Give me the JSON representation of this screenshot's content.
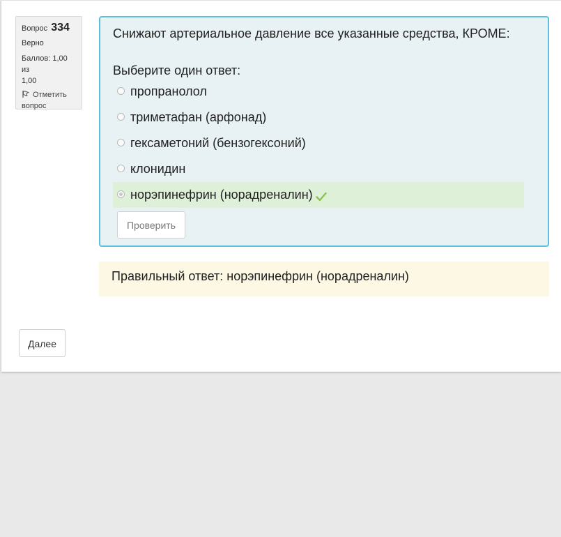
{
  "question_info": {
    "question_word": "Вопрос",
    "number": "334",
    "state": "Верно",
    "grade_line1": "Баллов: 1,00 из",
    "grade_line2": "1,00",
    "flag_line1": "Отметить",
    "flag_line2": "вопрос"
  },
  "question": {
    "text": "Снижают артериальное давление все указанные средства, КРОМЕ:",
    "prompt": "Выберите один ответ:",
    "options": [
      {
        "label": "пропранолол",
        "selected": false
      },
      {
        "label": "триметафан (арфонад)",
        "selected": false
      },
      {
        "label": "гексаметоний (бензогексоний)",
        "selected": false
      },
      {
        "label": "клонидин",
        "selected": false
      },
      {
        "label": "норэпинефрин (норадреналин)",
        "selected": true,
        "correct": true
      }
    ],
    "check_button": "Проверить"
  },
  "feedback": {
    "right_answer": "Правильный ответ: норэпинефрин (норадреналин)"
  },
  "navigation": {
    "next_button": "Далее"
  },
  "colors": {
    "formulation_bg": "#e8f2f5",
    "formulation_border": "#5bc0de",
    "correct_bg": "#dff0d8",
    "check_mark": "#8bc34a",
    "feedback_bg": "#fcf8e3"
  }
}
